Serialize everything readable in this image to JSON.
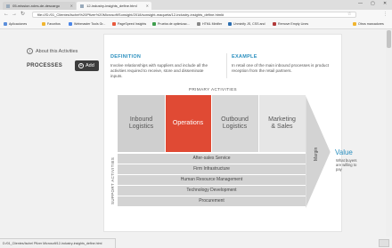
{
  "browser": {
    "tabs": [
      {
        "label": "05-mission-roles-de-descargo",
        "active": false
      },
      {
        "label": "12-industry-insights_define.html",
        "active": true
      }
    ],
    "window_controls": {
      "minimize": "—",
      "maximize": "▢",
      "close": "✕"
    },
    "address": "file:///D:/01_Clientes/Ischel%20Pfizer%20Microsoft/Sonsight/2018/sonsight-maqueta/12-industry-insights_define.html#",
    "bookmarks": [
      {
        "label": "Aplicaciones",
        "color": "#5a8edb"
      },
      {
        "label": "Favoritos",
        "color": "#f1b52f"
      },
      {
        "label": "Webmaster Tools Gr...",
        "color": "#4a86e8"
      },
      {
        "label": "PageSpeed Insights",
        "color": "#e8593c"
      },
      {
        "label": "Prueba de optimizac...",
        "color": "#3f9e4d"
      },
      {
        "label": "HTML Minifier",
        "color": "#888888"
      },
      {
        "label": "Unminify JS, CSS and",
        "color": "#2a6db0"
      },
      {
        "label": "Remove Empty Lines",
        "color": "#b23a3a"
      },
      {
        "label": "Otros marcadores",
        "color": "#f1b52f"
      }
    ]
  },
  "panel": {
    "about_label": "About this Activities",
    "processes_label": "PROCESSES",
    "add_label": "Add"
  },
  "definition": {
    "heading": "DEFINITION",
    "text": "Involve relationships with suppliers and include all the activities required to receive, store and disseminate inputs."
  },
  "example": {
    "heading": "EXAMPLE",
    "text": "In retail one of the main inbound processes is product reception from the retail partners."
  },
  "value_chain": {
    "primary_label": "PRIMARY ACTIVITIES",
    "support_label": "SUPPORT ACTIVITIES",
    "primary": [
      {
        "line1": "Inbound",
        "line2": "Logistics"
      },
      {
        "line1": "Operations",
        "line2": ""
      },
      {
        "line1": "Outbound",
        "line2": "Logistics"
      },
      {
        "line1": "Marketing",
        "line2": "& Sales"
      }
    ],
    "support": [
      "After-sales Service",
      "Firm Infrastructure",
      "Human Resource Management",
      "Technology Development",
      "Procurement"
    ],
    "margin_label": "Margin",
    "value_title": "Value",
    "value_subtitle": "What buyers are willing to pay",
    "colors": {
      "highlight": "#e04a34",
      "accent": "#2a8fbf"
    }
  },
  "status_bar": "D:/01_Clientes/Ischel Pfizer Microsoft/12-industry-insights_define.html"
}
